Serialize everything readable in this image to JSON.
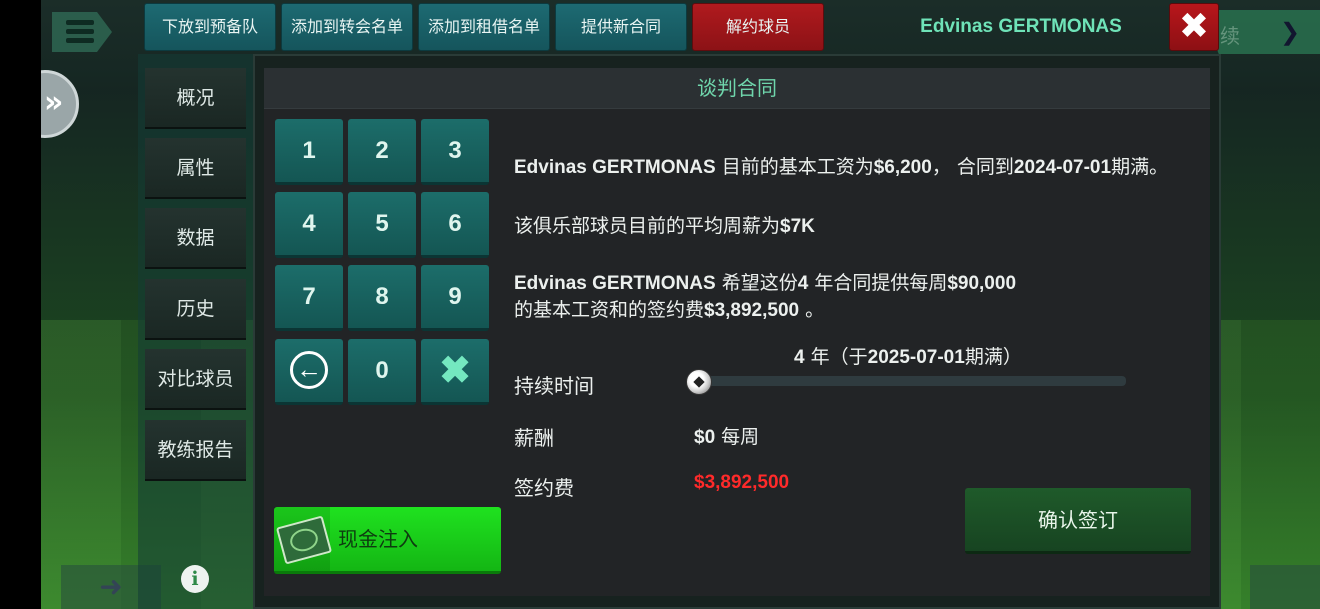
{
  "top_bar": {
    "release_to_reserve": "下放到预备队",
    "add_to_transfer_list": "添加到转会名单",
    "add_to_loan_list": "添加到租借名单",
    "offer_new_contract": "提供新合同",
    "terminate_player": "解约球员",
    "player_name": "Edvinas GERTMONAS",
    "close_glyph": "✖"
  },
  "background": {
    "continue_label": "续"
  },
  "nav": {
    "items": [
      "概况",
      "属性",
      "数据",
      "历史",
      "对比球员",
      "教练报告"
    ],
    "info_glyph": "i"
  },
  "panel": {
    "title": "谈判合同"
  },
  "keypad": {
    "keys": [
      "1",
      "2",
      "3",
      "4",
      "5",
      "6",
      "7",
      "8",
      "9"
    ],
    "zero": "0",
    "back_glyph": "←",
    "clear_glyph": "✖"
  },
  "cash_button": {
    "label": "现金注入"
  },
  "info": {
    "line1_name": "Edvinas GERTMONAS",
    "line1_text_a": " 目前的基本工资为",
    "line1_salary": "$6,200",
    "line1_text_b": "， 合同到",
    "line1_date": "2024-07-01",
    "line1_text_c": "期满。",
    "line2_text": "该俱乐部球员目前的平均周薪为",
    "line2_value": "$7K",
    "line3_name": "Edvinas GERTMONAS",
    "line3_text_a": " 希望这份",
    "line3_years": "4",
    "line3_text_b": " 年合同提供每周",
    "line3_salary": "$90,000",
    "line4_text_a": "的基本工资和的签约费",
    "line4_fee": "$3,892,500",
    "line4_text_b": " 。"
  },
  "duration": {
    "label": "持续时间",
    "value_years": "4",
    "value_text_a": " 年（于",
    "value_date": "2025-07-01",
    "value_text_b": "期满）",
    "slider_fraction": 0
  },
  "salary": {
    "label": "薪酬",
    "value": "$0",
    "unit": " 每周"
  },
  "signing_fee": {
    "label": "签约费",
    "value": "$3,892,500"
  },
  "confirm_button": {
    "label": "确认签订"
  },
  "colors": {
    "accent_green": "#6fd6ac",
    "terminate_red": "#b01a1e",
    "fee_red": "#ff2a2a",
    "key_teal": "#1c6d6a",
    "cash_green": "#1fe21f"
  }
}
